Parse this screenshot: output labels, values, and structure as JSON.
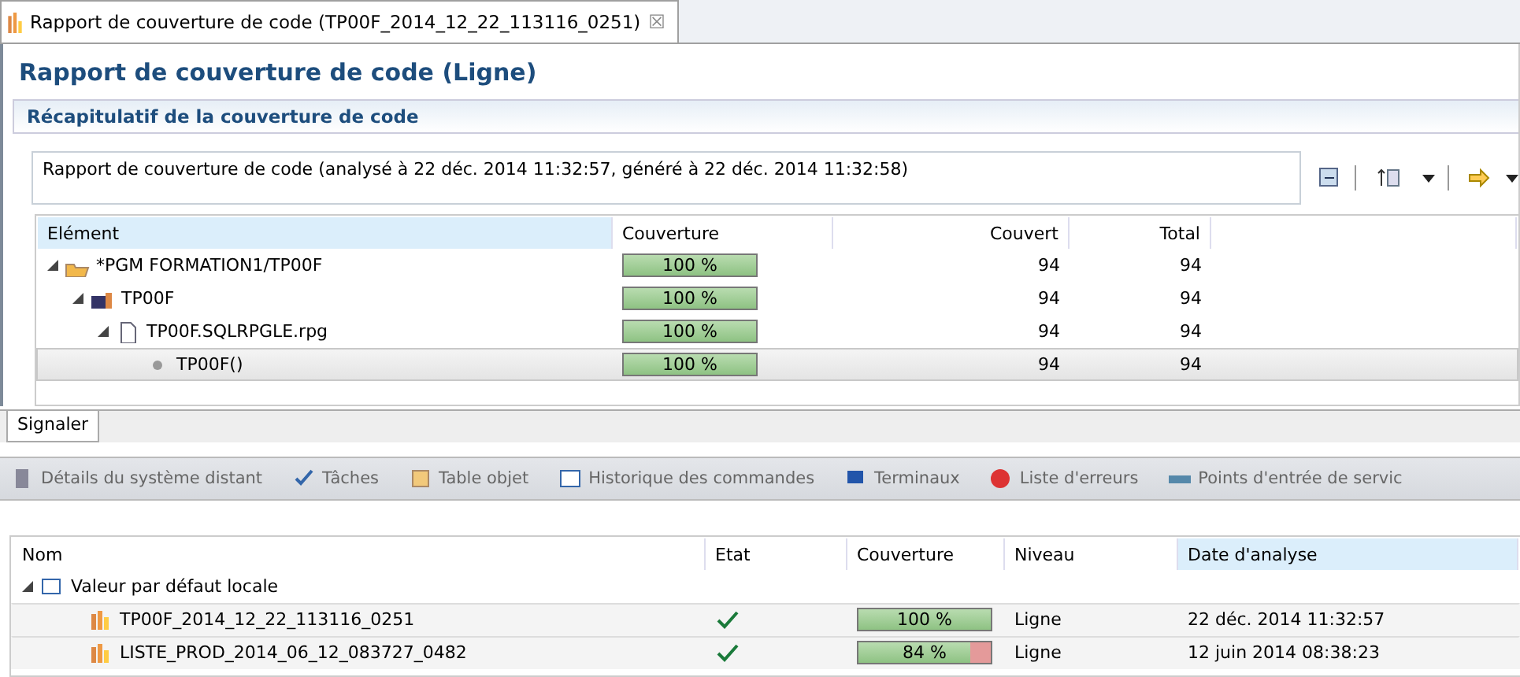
{
  "editor_tab": {
    "title": "Rapport de couverture de code (TP00F_2014_12_22_113116_0251)",
    "close": "☒"
  },
  "report_title": "Rapport de couverture de code (Ligne)",
  "section_title": "Récapitulatif de la couverture de code",
  "summary": "Rapport de couverture de code (analysé à 22 déc. 2014 11:32:57, généré à 22 déc. 2014 11:32:58)",
  "coverage_table": {
    "columns": [
      "Elément",
      "Couverture",
      "Couvert",
      "Total"
    ],
    "rows": [
      {
        "name": "*PGM FORMATION1/TP00F",
        "kind": "program",
        "coverage": "100 %",
        "level": 1,
        "covered": "94",
        "total": "94",
        "expanded": true,
        "selected": false,
        "children": [
          {
            "name": "TP00F",
            "kind": "module",
            "coverage": "100 %",
            "level": 1,
            "covered": "94",
            "total": "94",
            "expanded": true,
            "selected": false,
            "children": [
              {
                "name": "TP00F.SQLRPGLE.rpg",
                "kind": "file",
                "coverage": "100 %",
                "level": 1,
                "covered": "94",
                "total": "94",
                "expanded": true,
                "selected": false,
                "children": [
                  {
                    "name": "TP00F()",
                    "kind": "procedure",
                    "coverage": "100 %",
                    "level": 1,
                    "covered": "94",
                    "total": "94",
                    "selected": true
                  }
                ]
              }
            ]
          }
        ]
      }
    ]
  },
  "bottom_tab": "Signaler",
  "views": [
    {
      "label": "Détails du système distant",
      "kind": "server"
    },
    {
      "label": "Tâches",
      "kind": "tasks"
    },
    {
      "label": "Table objet",
      "kind": "table"
    },
    {
      "label": "Historique des commandes",
      "kind": "history"
    },
    {
      "label": "Terminaux",
      "kind": "terminal"
    },
    {
      "label": "Liste d'erreurs",
      "kind": "error"
    },
    {
      "label": "Points d'entrée de servic",
      "kind": "entry"
    }
  ],
  "results_table": {
    "columns": [
      "Nom",
      "Etat",
      "Couverture",
      "Niveau",
      "Date d'analyse"
    ],
    "groups": [
      {
        "name": "Valeur par défaut locale",
        "expanded": true,
        "children": [
          {
            "name": "TP00F_2014_12_22_113116_0251",
            "ok": true,
            "coverage": "100 %",
            "level": 1,
            "granularity": "Ligne",
            "date": "22 déc. 2014 11:32:57"
          },
          {
            "name": "LISTE_PROD_2014_06_12_083727_0482",
            "ok": true,
            "coverage": "84 %",
            "level": 0.84,
            "granularity": "Ligne",
            "date": "12 juin 2014 08:38:23"
          }
        ]
      }
    ]
  }
}
